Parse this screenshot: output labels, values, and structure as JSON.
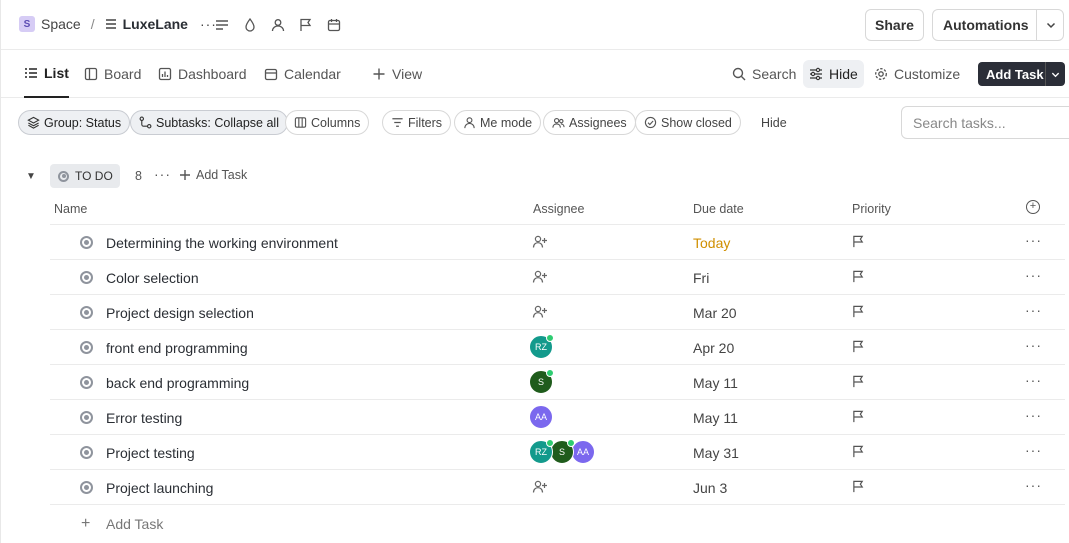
{
  "breadcrumb": {
    "space_badge": "S",
    "space_label": "Space",
    "separator": "/",
    "project_name": "LuxeLane",
    "more": "···"
  },
  "header_buttons": {
    "share": "Share",
    "automations": "Automations"
  },
  "views": {
    "tabs": [
      {
        "label": "List",
        "icon": "list-icon",
        "active": true
      },
      {
        "label": "Board",
        "icon": "board-icon"
      },
      {
        "label": "Dashboard",
        "icon": "dashboard-icon"
      },
      {
        "label": "Calendar",
        "icon": "calendar-icon"
      }
    ],
    "add_view": "View",
    "search": "Search",
    "hide": "Hide",
    "customize": "Customize",
    "add_task": "Add Task"
  },
  "filters": {
    "group": "Group: Status",
    "subtasks": "Subtasks: Collapse all",
    "columns": "Columns",
    "filters": "Filters",
    "me_mode": "Me mode",
    "assignees": "Assignees",
    "show_closed": "Show closed",
    "hide": "Hide",
    "search_placeholder": "Search tasks..."
  },
  "group": {
    "status": "TO DO",
    "count": "8",
    "more": "···",
    "add_task": "Add Task"
  },
  "columns": {
    "name": "Name",
    "assignee": "Assignee",
    "due_date": "Due date",
    "priority": "Priority"
  },
  "tasks": [
    {
      "name": "Determining the working environment",
      "assignees": [],
      "due": "Today",
      "due_color": "#d08f00"
    },
    {
      "name": "Color selection",
      "assignees": [],
      "due": "Fri"
    },
    {
      "name": "Project design selection",
      "assignees": [],
      "due": "Mar 20"
    },
    {
      "name": "front end programming",
      "assignees": [
        {
          "initials": "RZ",
          "color": "#139a8c",
          "online": true
        }
      ],
      "due": "Apr 20"
    },
    {
      "name": "back end programming",
      "assignees": [
        {
          "initials": "S",
          "color": "#1f5c1c",
          "online": true
        }
      ],
      "due": "May 11"
    },
    {
      "name": "Error testing",
      "assignees": [
        {
          "initials": "AA",
          "color": "#7b68ee",
          "online": false
        }
      ],
      "due": "May 11"
    },
    {
      "name": "Project testing",
      "assignees": [
        {
          "initials": "RZ",
          "color": "#139a8c",
          "online": true
        },
        {
          "initials": "S",
          "color": "#1f5c1c",
          "online": true
        },
        {
          "initials": "AA",
          "color": "#7b68ee",
          "online": false
        }
      ],
      "due": "May 31"
    },
    {
      "name": "Project launching",
      "assignees": [],
      "due": "Jun 3"
    }
  ],
  "row_more": "···",
  "add_task_row": {
    "plus": "+",
    "label": "Add Task"
  }
}
